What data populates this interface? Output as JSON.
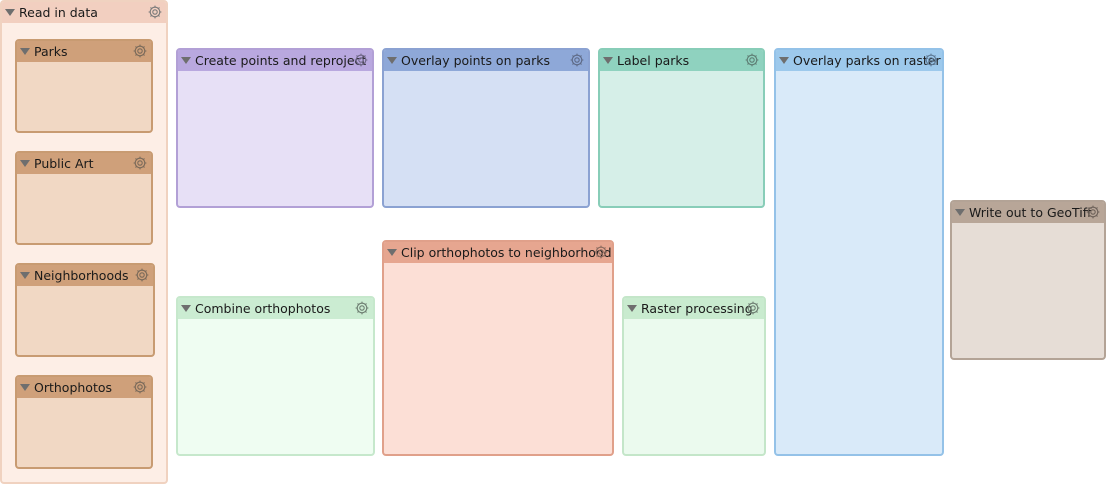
{
  "bookmarks": {
    "read_in_data": {
      "title": "Read in data"
    },
    "parks": {
      "title": "Parks"
    },
    "public_art": {
      "title": "Public Art"
    },
    "neighborhoods": {
      "title": "Neighborhoods"
    },
    "orthophotos": {
      "title": "Orthophotos"
    },
    "create_points": {
      "title": "Create points and reproject"
    },
    "overlay_points": {
      "title": "Overlay points on parks"
    },
    "label_parks": {
      "title": "Label parks"
    },
    "overlay_raster": {
      "title": "Overlay parks on raster"
    },
    "combine_ortho": {
      "title": "Combine orthophotos"
    },
    "clip_ortho": {
      "title": "Clip orthophotos to neighborhood"
    },
    "raster_processing": {
      "title": "Raster processing"
    },
    "write_geotiff": {
      "title": "Write out to GeoTiff"
    }
  },
  "icons": {
    "gear": "gear-icon",
    "collapse": "collapse-triangle-icon"
  },
  "colors": {
    "read_in_data": {
      "border": "#f0d2c0",
      "header": "#f2cfc0",
      "body": "#fdeee6"
    },
    "tan": {
      "border": "#c89b72",
      "header": "#cfa07a",
      "body": "#f1d8c4"
    },
    "purple": {
      "border": "#b2a0d6",
      "header": "#b9a8df",
      "body": "#e7e0f6"
    },
    "blue": {
      "border": "#8ba2d2",
      "header": "#8ea8d8",
      "body": "#d5e0f4"
    },
    "teal": {
      "border": "#88cdb8",
      "header": "#8fd2bf",
      "body": "#d6efe8"
    },
    "sky": {
      "border": "#94c2e8",
      "header": "#9dc9ec",
      "body": "#d9eaf9"
    },
    "mint": {
      "border": "#c6e8cc",
      "header": "#cbecd2",
      "body": "#effdf2"
    },
    "salmon": {
      "border": "#e0a08a",
      "header": "#e6a690",
      "body": "#fcdfd6"
    },
    "green": {
      "border": "#c4e6c9",
      "header": "#c9ebcf",
      "body": "#ebfaee"
    },
    "taupe": {
      "border": "#b3a396",
      "header": "#b8a698",
      "body": "#e6ddd6"
    }
  }
}
